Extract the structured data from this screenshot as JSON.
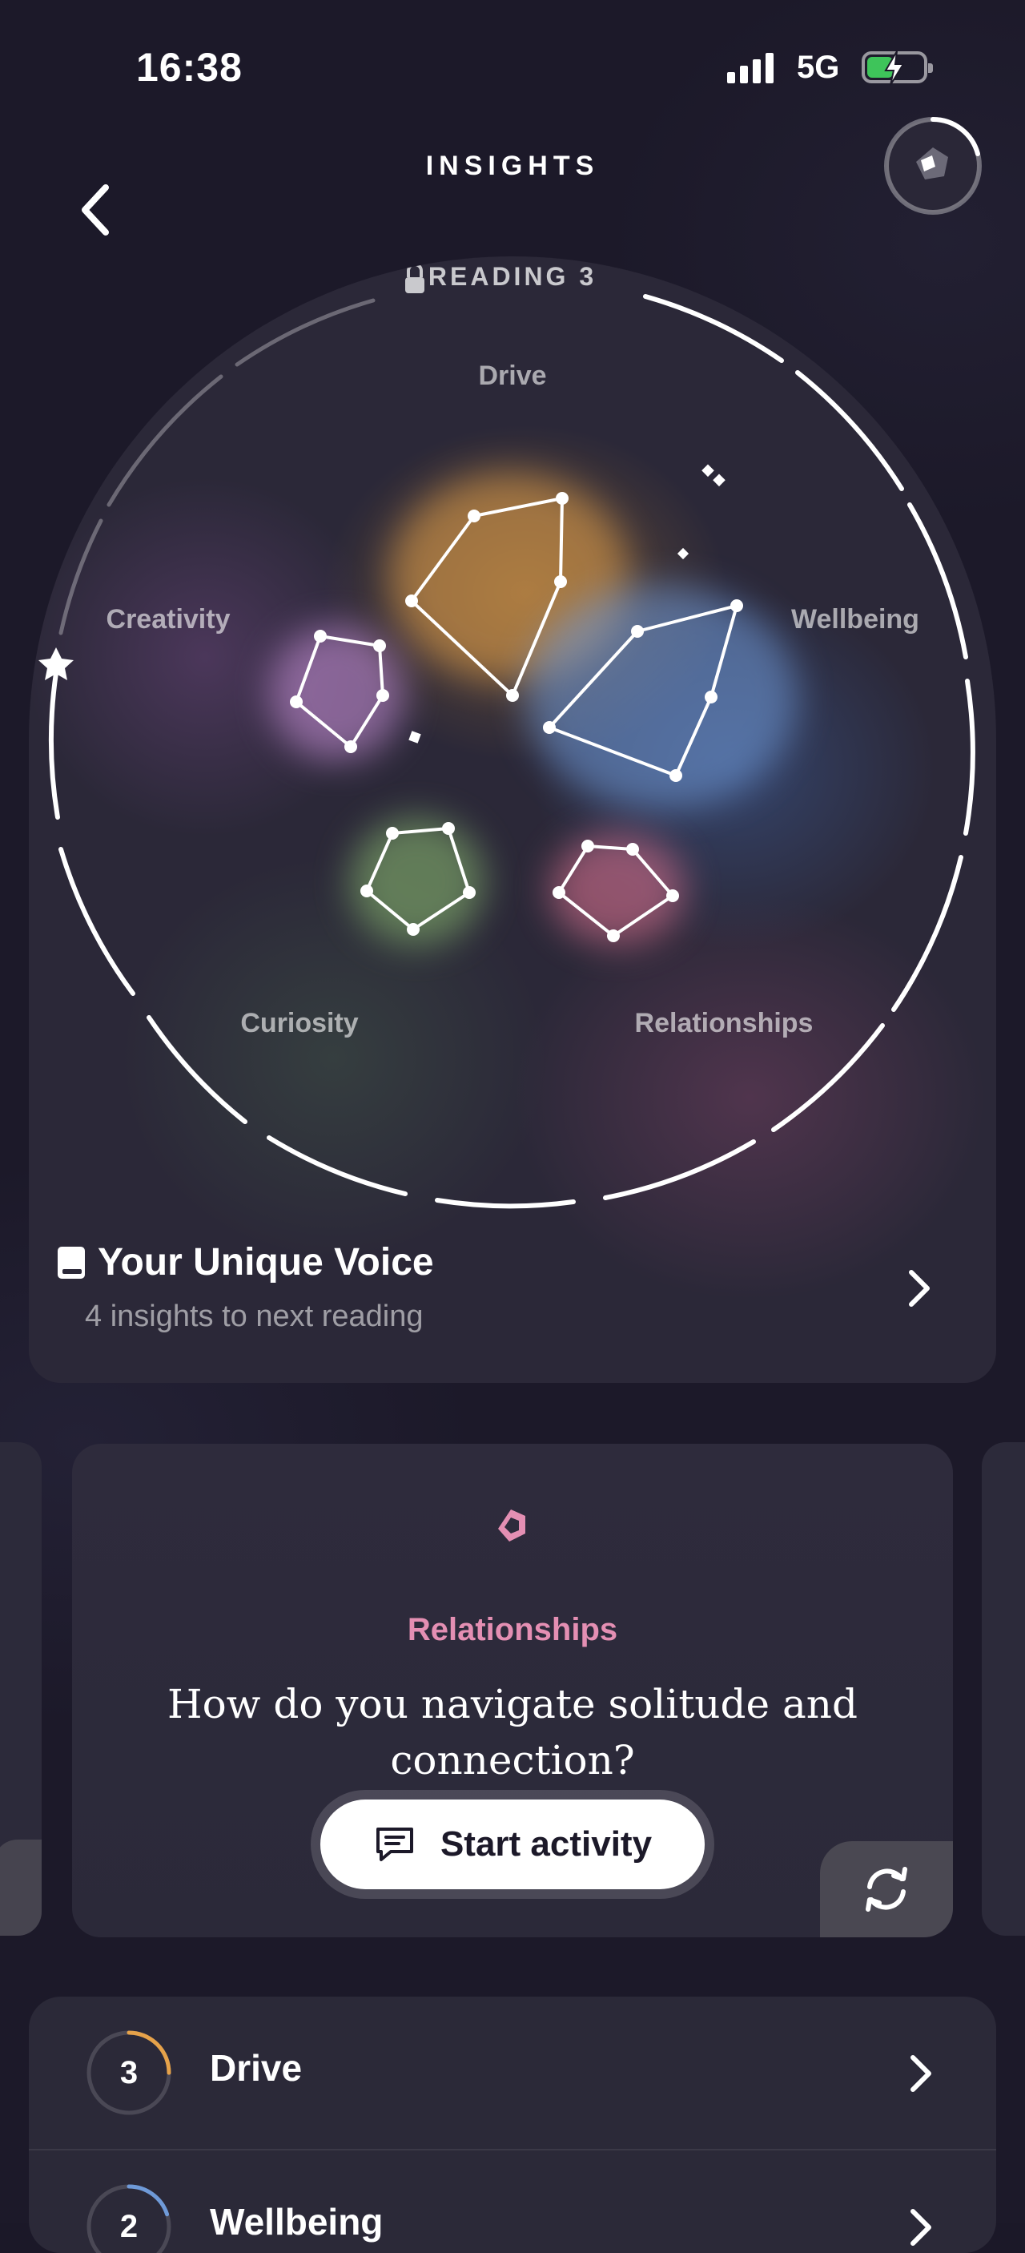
{
  "status_bar": {
    "time": "16:38",
    "network": "5G",
    "battery_charging": true
  },
  "header": {
    "title": "INSIGHTS"
  },
  "reading": {
    "label": "READING 3",
    "categories": [
      "Drive",
      "Creativity",
      "Wellbeing",
      "Curiosity",
      "Relationships"
    ],
    "colors": {
      "drive": "#e6a24a",
      "wellbeing": "#6f9ad8",
      "creativity": "#c18bd0",
      "curiosity": "#86b46e",
      "relationships": "#d46f8e"
    },
    "title": "Your Unique Voice",
    "subtitle": "4 insights to next reading"
  },
  "activity": {
    "category": "Relationships",
    "question": "How do you navigate solitude and connection?",
    "button_label": "Start activity"
  },
  "insights_list": [
    {
      "count": "3",
      "label": "Drive",
      "progress": 0.25,
      "color": "#e6a24a"
    },
    {
      "count": "2",
      "label": "Wellbeing",
      "progress": 0.2,
      "color": "#6f9ad8"
    }
  ]
}
